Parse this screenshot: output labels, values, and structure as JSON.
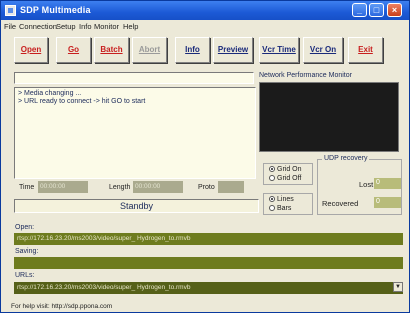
{
  "window": {
    "title": "SDP Multimedia"
  },
  "menu": [
    "File",
    "Connection",
    "Setup",
    "Info",
    "Monitor",
    "Help"
  ],
  "toolbar": {
    "open": "Open",
    "go": "Go",
    "batch": "Batch",
    "abort": "Abort",
    "info": "Info",
    "preview": "Preview",
    "vcr_time": "Vcr Time",
    "vcr_on": "Vcr On",
    "exit": "Exit"
  },
  "log": {
    "lines": [
      "> Media changing ...",
      "> URL ready to connect -> hit GO to start"
    ]
  },
  "network_monitor": {
    "label": "Network Performance Monitor"
  },
  "grid": {
    "on_label": "Grid On",
    "off_label": "Grid Off",
    "selected": "on"
  },
  "mode": {
    "lines_label": "Lines",
    "bars_label": "Bars",
    "selected": "lines"
  },
  "udp": {
    "title": "UDP recovery",
    "lost_label": "Lost",
    "lost_value": "0",
    "recovered_label": "Recovered",
    "recovered_value": "0"
  },
  "fields": {
    "time_label": "Time",
    "time_value": "00:00:00",
    "length_label": "Length",
    "length_value": "00:00:00",
    "proto_label": "Proto",
    "proto_value": ""
  },
  "status": "Standby",
  "open_section": {
    "label": "Open:",
    "value": "rtsp://172.16.23.20/ms2003/video/super_ Hydrogen_to.rmvb"
  },
  "saving_section": {
    "label": "Saving:",
    "value": ""
  },
  "urls_section": {
    "label": "URLs:",
    "value": "rtsp://172.16.23.20/ms2003/video/super_ Hydrogen_to.rmvb"
  },
  "footer": {
    "text": "For help visit: http://sdp.ppona.com"
  }
}
